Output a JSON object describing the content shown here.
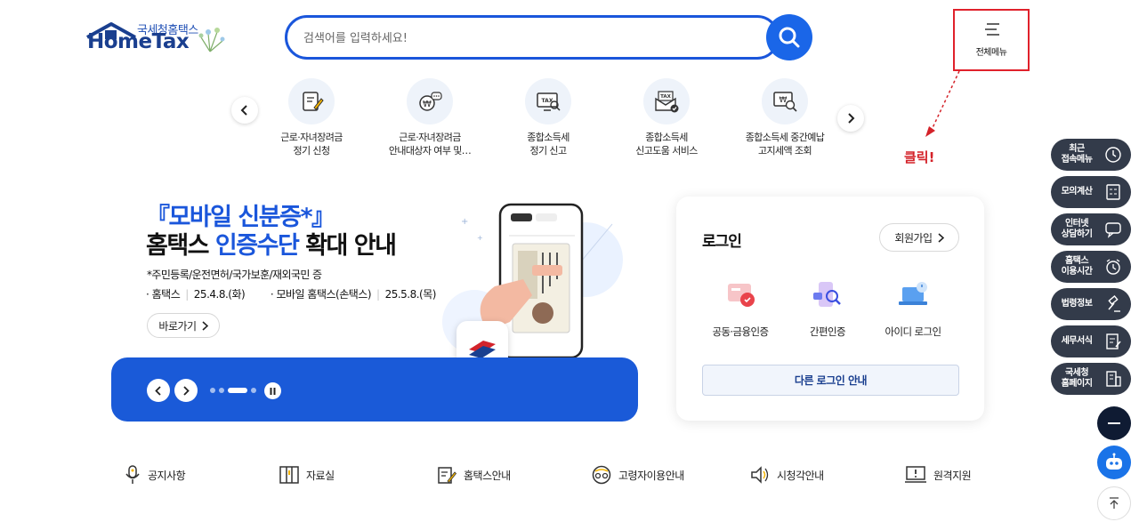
{
  "header": {
    "logo_small": "국세청홈택스",
    "logo_big": "HomeTax",
    "search_placeholder": "검색어를 입력하세요!",
    "full_menu_label": "전체메뉴",
    "click_annotation": "클릭!"
  },
  "quick_services": [
    {
      "line1": "근로·자녀장려금",
      "line2": "정기 신청",
      "icon": "document-pen-icon"
    },
    {
      "line1": "근로·자녀장려금",
      "line2": "안내대상자 여부 및…",
      "icon": "coin-chat-icon"
    },
    {
      "line1": "종합소득세",
      "line2": "정기 신고",
      "icon": "tax-monitor-icon"
    },
    {
      "line1": "종합소득세",
      "line2": "신고도움 서비스",
      "icon": "tax-envelope-icon"
    },
    {
      "line1": "종합소득세 중간예납",
      "line2": "고지세액 조회",
      "icon": "won-magnifier-icon"
    }
  ],
  "banner": {
    "title_line1": "『모바일 신분증*』",
    "title_line2_a": "홈택스 ",
    "title_line2_b": "인증수단",
    "title_line2_c": " 확대 안내",
    "subtitle": "*주민등록/운전면허/국가보훈/재외국민 증",
    "date1_label": "· 홈택스",
    "date1_value": "25.4.8.(화)",
    "date2_label": "· 모바일 홈택스(손택스)",
    "date2_value": "25.5.8.(목)",
    "goto_label": "바로가기"
  },
  "login": {
    "title": "로그인",
    "signup_label": "회원가입",
    "options": [
      "공동·금융인증",
      "간편인증",
      "아이디 로그인"
    ],
    "other_login_label": "다른 로그인 안내"
  },
  "bottom_links": [
    {
      "label": "공지사항",
      "icon": "microphone-icon"
    },
    {
      "label": "자료실",
      "icon": "book-icon"
    },
    {
      "label": "홈택스안내",
      "icon": "pen-document-icon"
    },
    {
      "label": "고령자이용안내",
      "icon": "glasses-icon"
    },
    {
      "label": "시청각안내",
      "icon": "speaker-icon"
    },
    {
      "label": "원격지원",
      "icon": "monitor-alert-icon"
    }
  ],
  "side_menu": [
    {
      "label1": "최근",
      "label2": "접속메뉴",
      "icon": "clock-icon"
    },
    {
      "label1": "모의계산",
      "label2": "",
      "icon": "calculator-icon"
    },
    {
      "label1": "인터넷",
      "label2": "상담하기",
      "icon": "chat-icon"
    },
    {
      "label1": "홈택스",
      "label2": "이용시간",
      "icon": "alarm-icon"
    },
    {
      "label1": "법령정보",
      "label2": "",
      "icon": "gavel-icon"
    },
    {
      "label1": "세무서식",
      "label2": "",
      "icon": "form-icon"
    },
    {
      "label1": "국세청",
      "label2": "홈페이지",
      "icon": "building-icon"
    }
  ],
  "colors": {
    "primary": "#1a56db",
    "banner_bar": "#1a5ad8",
    "side_menu_bg": "#333b4a",
    "highlight_red": "#e0212b"
  }
}
